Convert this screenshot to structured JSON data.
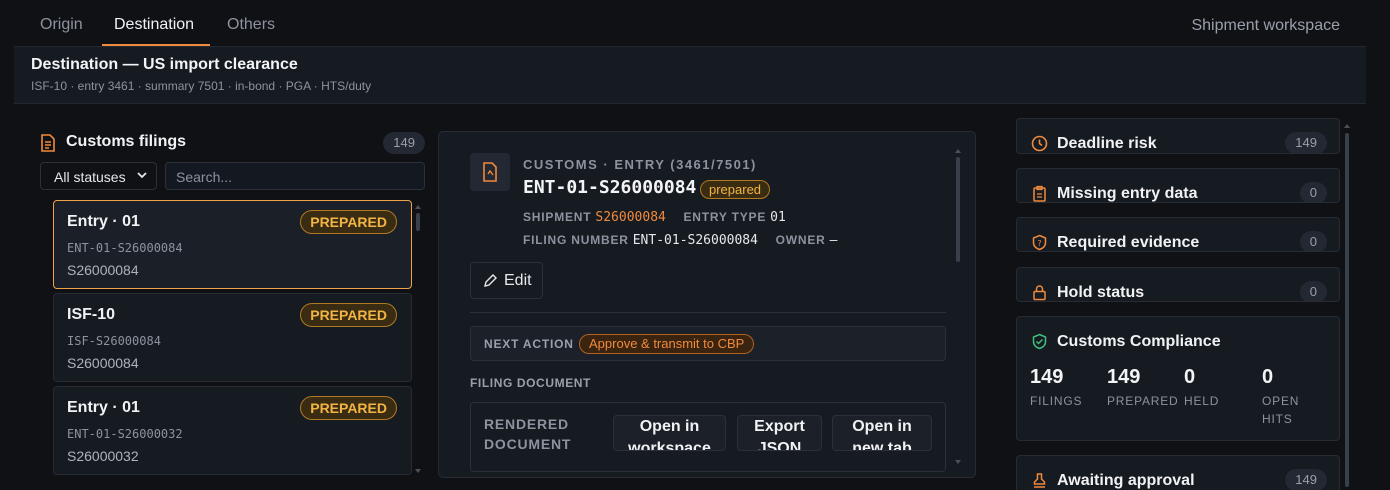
{
  "tabs": [
    {
      "label": "Origin"
    },
    {
      "label": "Destination"
    },
    {
      "label": "Others"
    }
  ],
  "workspace_link": "Shipment workspace",
  "header": {
    "title": "Destination — US import clearance",
    "subtitle": "ISF-10 · entry 3461 · summary 7501 · in-bond · PGA · HTS/duty"
  },
  "filings": {
    "title": "Customs filings",
    "count": "149",
    "status_filter": "All statuses",
    "search_placeholder": "Search...",
    "items": [
      {
        "title": "Entry · 01",
        "badge": "PREPARED",
        "ref": "ENT-01-S26000084",
        "shipment": "S26000084"
      },
      {
        "title": "ISF-10",
        "badge": "PREPARED",
        "ref": "ISF-S26000084",
        "shipment": "S26000084"
      },
      {
        "title": "Entry · 01",
        "badge": "PREPARED",
        "ref": "ENT-01-S26000032",
        "shipment": "S26000032"
      }
    ]
  },
  "detail": {
    "kicker": "CUSTOMS · ENTRY (3461/7501)",
    "entry_id": "ENT-01-S26000084",
    "status": "prepared",
    "shipment_label": "SHIPMENT",
    "shipment_value": "S26000084",
    "entry_type_label": "ENTRY TYPE",
    "entry_type_value": "01",
    "filing_number_label": "FILING NUMBER",
    "filing_number_value": "ENT-01-S26000084",
    "owner_label": "OWNER",
    "owner_value": "—",
    "edit_label": "Edit",
    "next_action_label": "NEXT ACTION",
    "next_action_value": "Approve & transmit to CBP",
    "filing_document_label": "FILING DOCUMENT",
    "rendered_label_1": "RENDERED",
    "rendered_label_2": "DOCUMENT",
    "btn_open_workspace_1": "Open in",
    "btn_open_workspace_2": "workspace",
    "btn_export_1": "Export",
    "btn_export_2": "JSON",
    "btn_newtab_1": "Open in",
    "btn_newtab_2": "new tab"
  },
  "right": {
    "deadline_risk": {
      "title": "Deadline risk",
      "count": "149"
    },
    "missing_entry": {
      "title": "Missing entry data",
      "count": "0"
    },
    "required_evidence": {
      "title": "Required evidence",
      "count": "0"
    },
    "hold_status": {
      "title": "Hold status",
      "count": "0"
    },
    "compliance": {
      "title": "Customs Compliance",
      "stats": [
        {
          "value": "149",
          "label": "FILINGS"
        },
        {
          "value": "149",
          "label": "PREPARED"
        },
        {
          "value": "0",
          "label": "HELD"
        },
        {
          "value": "0",
          "label_1": "OPEN",
          "label_2": "HITS"
        }
      ]
    },
    "awaiting_approval": {
      "title": "Awaiting approval",
      "count": "149"
    }
  },
  "colors": {
    "accent": "#f08a3c",
    "badge_text": "#f2b544",
    "compliance_icon": "#3fbf7f"
  }
}
